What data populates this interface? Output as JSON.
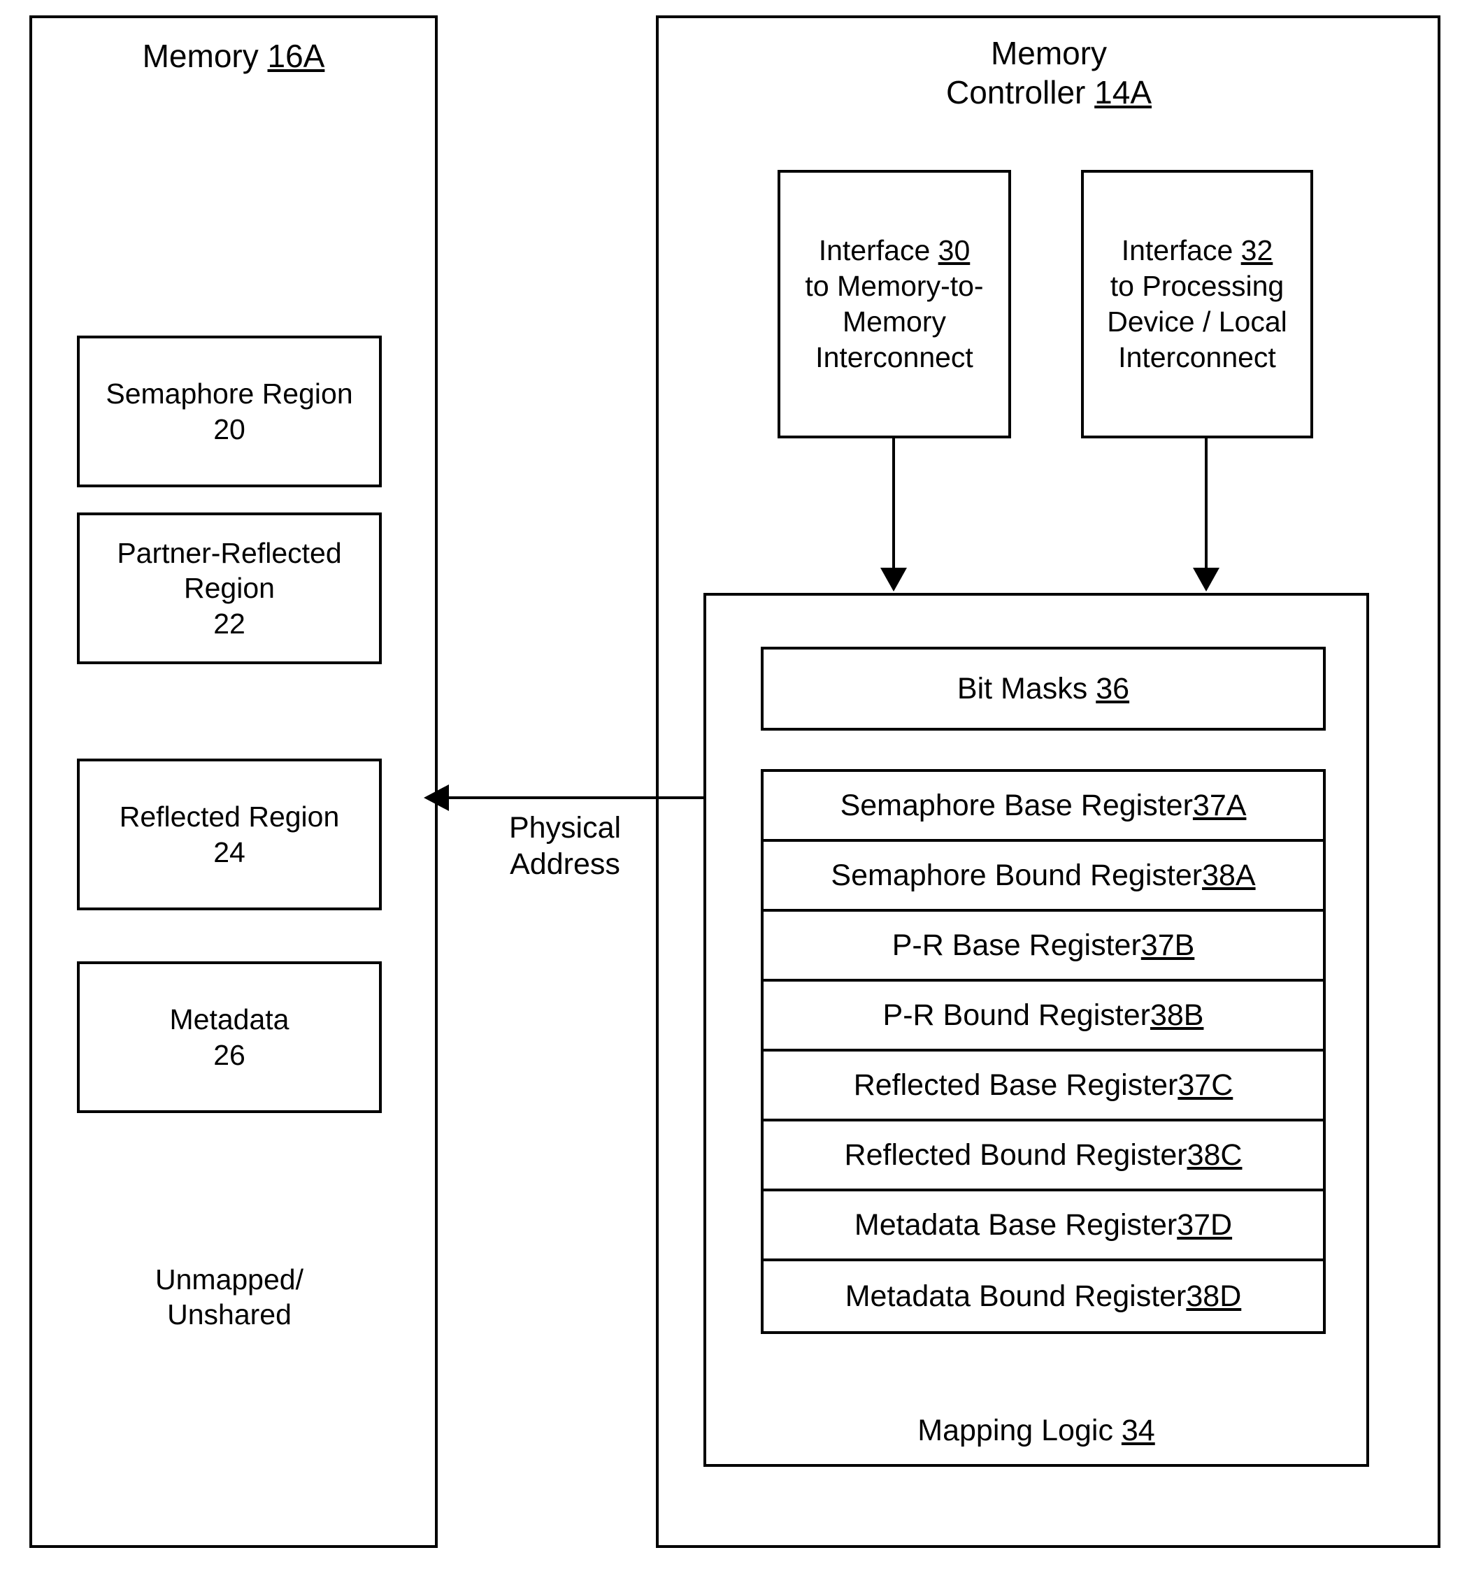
{
  "diagram": {
    "memory": {
      "title_text": "Memory ",
      "title_ref": "16A",
      "regions": [
        {
          "name": "semaphore",
          "label": "Semaphore Region\n20"
        },
        {
          "name": "partner-reflected",
          "label": "Partner-Reflected\nRegion\n22"
        },
        {
          "name": "reflected",
          "label": "Reflected Region\n24"
        },
        {
          "name": "metadata",
          "label": "Metadata\n26"
        }
      ],
      "unmapped_label": "Unmapped/\nUnshared"
    },
    "controller": {
      "title_text": "Memory\nController ",
      "title_ref": "14A",
      "interfaces": [
        {
          "name": "interface-30",
          "line1_text": "Interface ",
          "line1_ref": "30",
          "line2": "\nto Memory-to-\nMemory\nInterconnect"
        },
        {
          "name": "interface-32",
          "line1_text": "Interface ",
          "line1_ref": "32",
          "line2": "\nto Processing\nDevice / Local\nInterconnect"
        }
      ],
      "bit_masks": {
        "label_text": "Bit Masks  ",
        "label_ref": "36"
      },
      "registers": [
        {
          "text": "Semaphore Base Register ",
          "ref": "37A"
        },
        {
          "text": "Semaphore Bound Register ",
          "ref": "38A"
        },
        {
          "text": "P-R Base Register ",
          "ref": "37B"
        },
        {
          "text": "P-R Bound Register ",
          "ref": "38B"
        },
        {
          "text": "Reflected Base Register ",
          "ref": "37C"
        },
        {
          "text": "Reflected Bound Register ",
          "ref": "38C"
        },
        {
          "text": "Metadata Base Register ",
          "ref": "37D"
        },
        {
          "text": "Metadata Bound Register ",
          "ref": "38D"
        }
      ],
      "mapping_logic": {
        "label_text": "Mapping Logic ",
        "label_ref": "34"
      }
    },
    "connections": {
      "physical_address_label": "Physical\nAddress"
    }
  }
}
